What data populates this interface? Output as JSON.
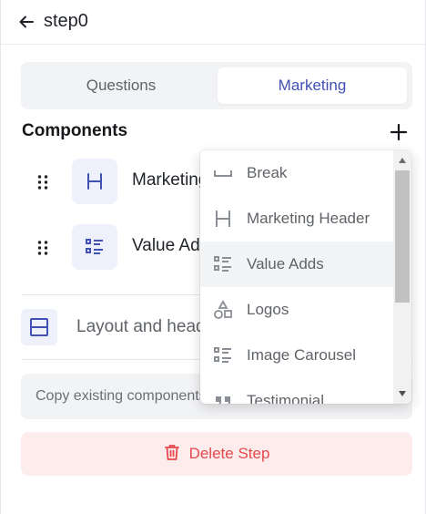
{
  "header": {
    "title": "step0",
    "back_icon": "arrow-left-icon"
  },
  "tabs": [
    {
      "label": "Questions",
      "active": false
    },
    {
      "label": "Marketing",
      "active": true
    }
  ],
  "components": {
    "heading": "Components",
    "add_icon": "plus-icon",
    "items": [
      {
        "label": "Marketing Header",
        "icon": "heading-h-icon"
      },
      {
        "label": "Value Adds",
        "icon": "list-icon"
      }
    ]
  },
  "layout": {
    "label": "Layout and header",
    "icon": "layout-icon"
  },
  "copy_existing": {
    "placeholder": "Copy existing components"
  },
  "delete": {
    "label": "Delete Step",
    "icon": "trash-icon"
  },
  "dropdown": {
    "items": [
      {
        "label": "Break",
        "icon": "break-icon"
      },
      {
        "label": "Marketing Header",
        "icon": "heading-h-icon"
      },
      {
        "label": "Value Adds",
        "icon": "list-icon"
      },
      {
        "label": "Logos",
        "icon": "shapes-icon"
      },
      {
        "label": "Image Carousel",
        "icon": "list-icon"
      },
      {
        "label": "Testimonial",
        "icon": "quote-icon"
      }
    ],
    "hovered_item": "Value Adds"
  },
  "colors": {
    "accent": "#4050b5",
    "danger": "#e5484d",
    "danger_bg": "#fdecec",
    "icon_bg": "#eef1fb"
  }
}
